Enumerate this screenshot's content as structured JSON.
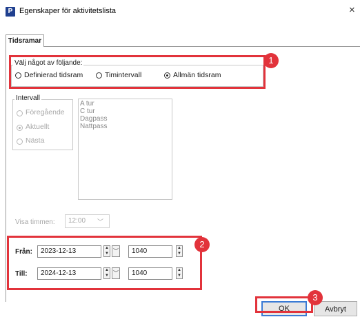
{
  "window": {
    "app_icon_letter": "P",
    "title": "Egenskaper för aktivitetslista",
    "close_glyph": "×"
  },
  "tab": {
    "label": "Tidsramar"
  },
  "choice_group": {
    "legend": "Välj något av följande:",
    "options": [
      {
        "label": "Definierad tidsram",
        "selected": false
      },
      {
        "label": "Timintervall",
        "selected": false
      },
      {
        "label": "Allmän tidsram",
        "selected": true
      }
    ]
  },
  "interval_group": {
    "legend": "Intervall",
    "options": [
      {
        "label": "Föregående",
        "selected": false,
        "enabled": false
      },
      {
        "label": "Aktuellt",
        "selected": true,
        "enabled": false
      },
      {
        "label": "Nästa",
        "selected": false,
        "enabled": false
      }
    ]
  },
  "shift_list": {
    "items": [
      "A tur",
      "C tur",
      "Dagpass",
      "Nattpass"
    ]
  },
  "show_hour": {
    "label": "Visa timmen:",
    "value": "12:00"
  },
  "from": {
    "label": "Från:",
    "date": "2023-12-13",
    "time": "1040"
  },
  "to": {
    "label": "Till:",
    "date": "2024-12-13",
    "time": "1040"
  },
  "buttons": {
    "ok": "OK",
    "cancel": "Avbryt"
  },
  "annotations": {
    "badge1": "1",
    "badge2": "2",
    "badge3": "3",
    "color": "#e2333b"
  },
  "icons": {
    "spin_up": "▲",
    "spin_down": "▼",
    "chevron": "﹀"
  }
}
